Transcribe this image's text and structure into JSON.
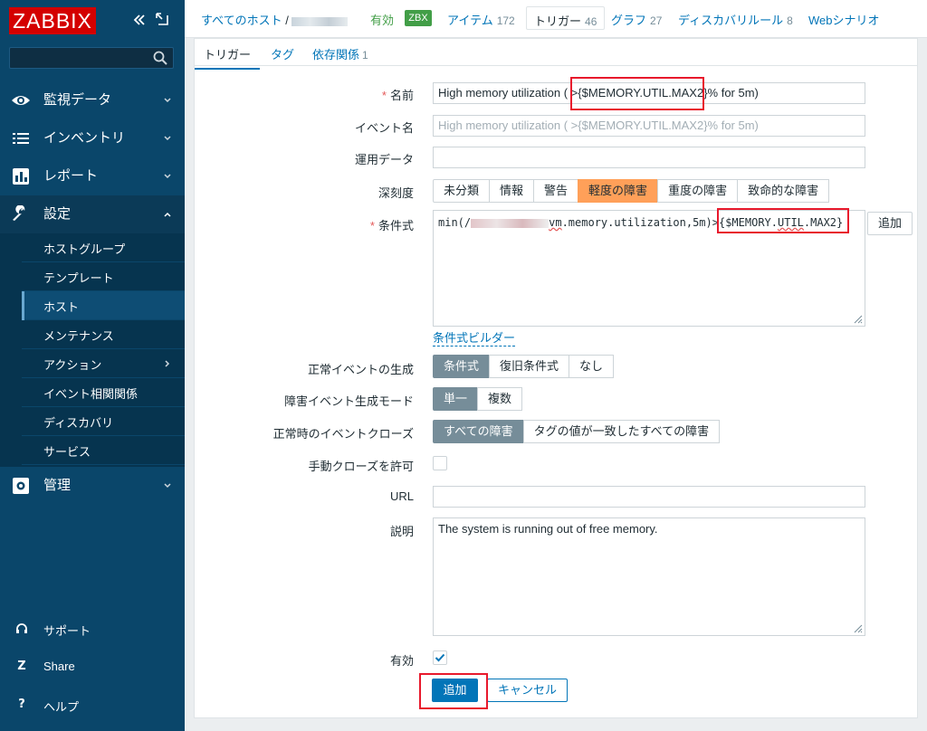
{
  "sidebar": {
    "logo": "ZABBIX",
    "search_placeholder": "",
    "menu": [
      {
        "label": "監視データ"
      },
      {
        "label": "インベントリ"
      },
      {
        "label": "レポート"
      },
      {
        "label": "設定"
      },
      {
        "label": "管理"
      }
    ],
    "submenu": [
      {
        "label": "ホストグループ"
      },
      {
        "label": "テンプレート"
      },
      {
        "label": "ホスト"
      },
      {
        "label": "メンテナンス"
      },
      {
        "label": "アクション"
      },
      {
        "label": "イベント相関関係"
      },
      {
        "label": "ディスカバリ"
      },
      {
        "label": "サービス"
      }
    ],
    "footer": [
      {
        "label": "サポート"
      },
      {
        "label": "Share",
        "icon_letter": "Z"
      },
      {
        "label": "ヘルプ",
        "icon_letter": "?"
      }
    ]
  },
  "topnav": {
    "all_hosts": "すべてのホスト",
    "separator": "/",
    "status": "有効",
    "zbx": "ZBX",
    "items_label": "アイテム",
    "items_count": "172",
    "triggers_label": "トリガー",
    "triggers_count": "46",
    "graphs_label": "グラフ",
    "graphs_count": "27",
    "discovery_label": "ディスカバリルール",
    "discovery_count": "8",
    "web_label": "Webシナリオ"
  },
  "tabs": {
    "trigger": "トリガー",
    "tags": "タグ",
    "deps_label": "依存関係",
    "deps_count": "1"
  },
  "form": {
    "name_label": "名前",
    "name_value": "High memory utilization ( >{$MEMORY.UTIL.MAX2}% for 5m)",
    "event_name_label": "イベント名",
    "event_name_placeholder": "High memory utilization ( >{$MEMORY.UTIL.MAX2}% for 5m)",
    "opdata_label": "運用データ",
    "severity_label": "深刻度",
    "severities": [
      "未分類",
      "情報",
      "警告",
      "軽度の障害",
      "重度の障害",
      "致命的な障害"
    ],
    "severity_selected": "軽度の障害",
    "expression_label": "条件式",
    "expression_prefix": "min(/",
    "expression_mid": "vm",
    "expression_rest": ".memory.utilization,5m)>",
    "expression_macro_a": "{$MEMORY.",
    "expression_macro_b": "UTIL",
    "expression_macro_c": ".MAX2}",
    "add_expression": "追加",
    "expression_builder": "条件式ビルダー",
    "ok_event_label": "正常イベントの生成",
    "ok_event_options": [
      "条件式",
      "復旧条件式",
      "なし"
    ],
    "problem_mode_label": "障害イベント生成モード",
    "problem_mode_options": [
      "単一",
      "複数"
    ],
    "ok_close_label": "正常時のイベントクローズ",
    "ok_close_options": [
      "すべての障害",
      "タグの値が一致したすべての障害"
    ],
    "manual_close_label": "手動クローズを許可",
    "url_label": "URL",
    "url_value": "",
    "description_label": "説明",
    "description_value": "The system is running out of free memory.",
    "enabled_label": "有効",
    "submit": "追加",
    "cancel": "キャンセル"
  },
  "colors": {
    "sidebar": "#0a466a",
    "accent": "#0275b8",
    "severity_average": "#ffa059",
    "highlight": "#e8192c"
  }
}
